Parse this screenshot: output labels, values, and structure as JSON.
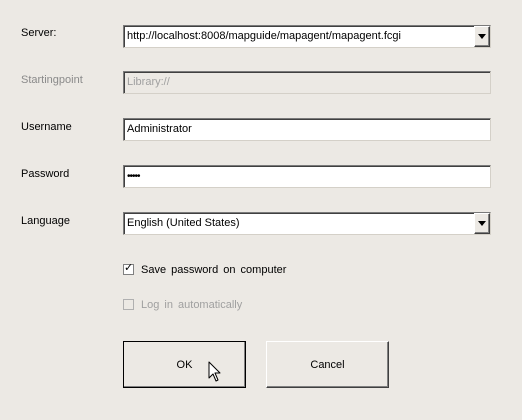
{
  "form": {
    "server": {
      "label": "Server:",
      "value": "http://localhost:8008/mapguide/mapagent/mapagent.fcgi"
    },
    "startingpoint": {
      "label": "Startingpoint",
      "placeholder": "Library://"
    },
    "username": {
      "label": "Username",
      "value": "Administrator"
    },
    "password": {
      "label": "Password",
      "value": "•••••"
    },
    "language": {
      "label": "Language",
      "value": "English  (United States)"
    },
    "save_password": {
      "label": "Save  password  on  computer",
      "checked": true
    },
    "auto_login": {
      "label": "Log  in  automatically",
      "checked": false
    }
  },
  "buttons": {
    "ok_label": "OK",
    "cancel_label": "Cancel"
  },
  "icons": {
    "check": "✓",
    "dropdown": "chevron-down-icon",
    "cursor": "mouse-pointer-icon"
  }
}
